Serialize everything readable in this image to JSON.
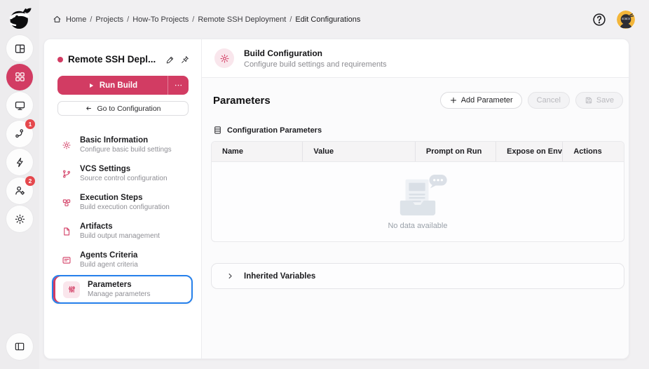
{
  "colors": {
    "accent": "#d23c63",
    "selection": "#2680eb",
    "badge": "#e5484d",
    "avatar_bg": "#f3b63a"
  },
  "topbar": {
    "breadcrumb": {
      "items": [
        "Home",
        "Projects",
        "How-To Projects",
        "Remote SSH Deployment",
        "Edit Configurations"
      ],
      "separator": "/"
    }
  },
  "rail": {
    "badges": {
      "pipelines": "1",
      "users": "2"
    }
  },
  "sidebar": {
    "project_title": "Remote SSH Depl...",
    "run_build_label": "Run Build",
    "goto_label": "Go to Configuration",
    "nav": [
      {
        "title": "Basic Information",
        "subtitle": "Configure basic build settings"
      },
      {
        "title": "VCS Settings",
        "subtitle": "Source control configuration"
      },
      {
        "title": "Execution Steps",
        "subtitle": "Build execution configuration"
      },
      {
        "title": "Artifacts",
        "subtitle": "Build output management"
      },
      {
        "title": "Agents Criteria",
        "subtitle": "Build agent criteria"
      },
      {
        "title": "Parameters",
        "subtitle": "Manage parameters"
      }
    ]
  },
  "main": {
    "header": {
      "title": "Build Configuration",
      "subtitle": "Configure build settings and requirements"
    },
    "page_title": "Parameters",
    "actions": {
      "add": "Add Parameter",
      "cancel": "Cancel",
      "save": "Save"
    },
    "group_label": "Configuration Parameters",
    "table": {
      "columns": [
        "Name",
        "Value",
        "Prompt on Run",
        "Expose on Env",
        "Actions"
      ],
      "rows": [],
      "empty_text": "No data available"
    },
    "inherited_label": "Inherited Variables"
  }
}
